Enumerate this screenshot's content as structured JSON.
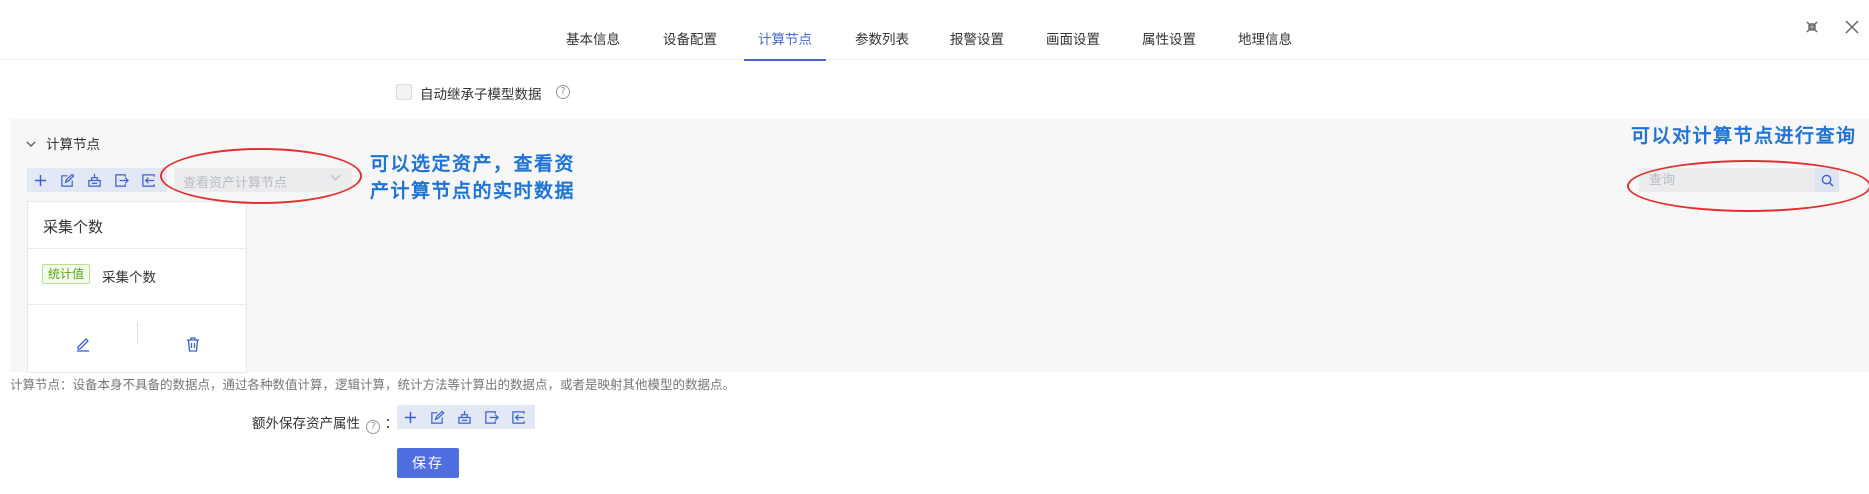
{
  "tabs": [
    {
      "label": "基本信息",
      "active": false
    },
    {
      "label": "设备配置",
      "active": false
    },
    {
      "label": "计算节点",
      "active": true
    },
    {
      "label": "参数列表",
      "active": false
    },
    {
      "label": "报警设置",
      "active": false
    },
    {
      "label": "画面设置",
      "active": false
    },
    {
      "label": "属性设置",
      "active": false
    },
    {
      "label": "地理信息",
      "active": false
    }
  ],
  "window": {
    "fullscreen_icon": "fullscreen-icon",
    "close_icon": "close-icon"
  },
  "inherit": {
    "label": "自动继承子模型数据",
    "checked": false,
    "help_icon": "question-circle-icon"
  },
  "section": {
    "title": "计算节点",
    "expanded": true,
    "toolbar_icons": [
      "plus-icon",
      "edit-icon",
      "import-icon",
      "export-icon",
      "export-alt-icon"
    ],
    "asset_select_placeholder": "查看资产计算节点",
    "search_placeholder": "查询",
    "search_icon": "search-icon",
    "card": {
      "title": "采集个数",
      "tag": "统计值",
      "value": "采集个数",
      "actions": [
        "edit-icon",
        "trash-icon"
      ]
    }
  },
  "annotations": {
    "select_note_line1": "可以选定资产，查看资",
    "select_note_line2": "产计算节点的实时数据",
    "search_note": "可以对计算节点进行查询"
  },
  "description": "计算节点：设备本身不具备的数据点，通过各种数值计算，逻辑计算，统计方法等计算出的数据点，或者是映射其他模型的数据点。",
  "extra": {
    "label": "额外保存资产属性",
    "colon": "：",
    "toolbar_icons": [
      "plus-icon",
      "edit-icon",
      "import-icon",
      "export-icon",
      "export-alt-icon"
    ]
  },
  "save_label": "保存",
  "colors": {
    "accent": "#4a69d6",
    "annotation_blue": "#1e73d6",
    "annotation_red": "#e3302f",
    "tag_green": "#52a31a"
  }
}
